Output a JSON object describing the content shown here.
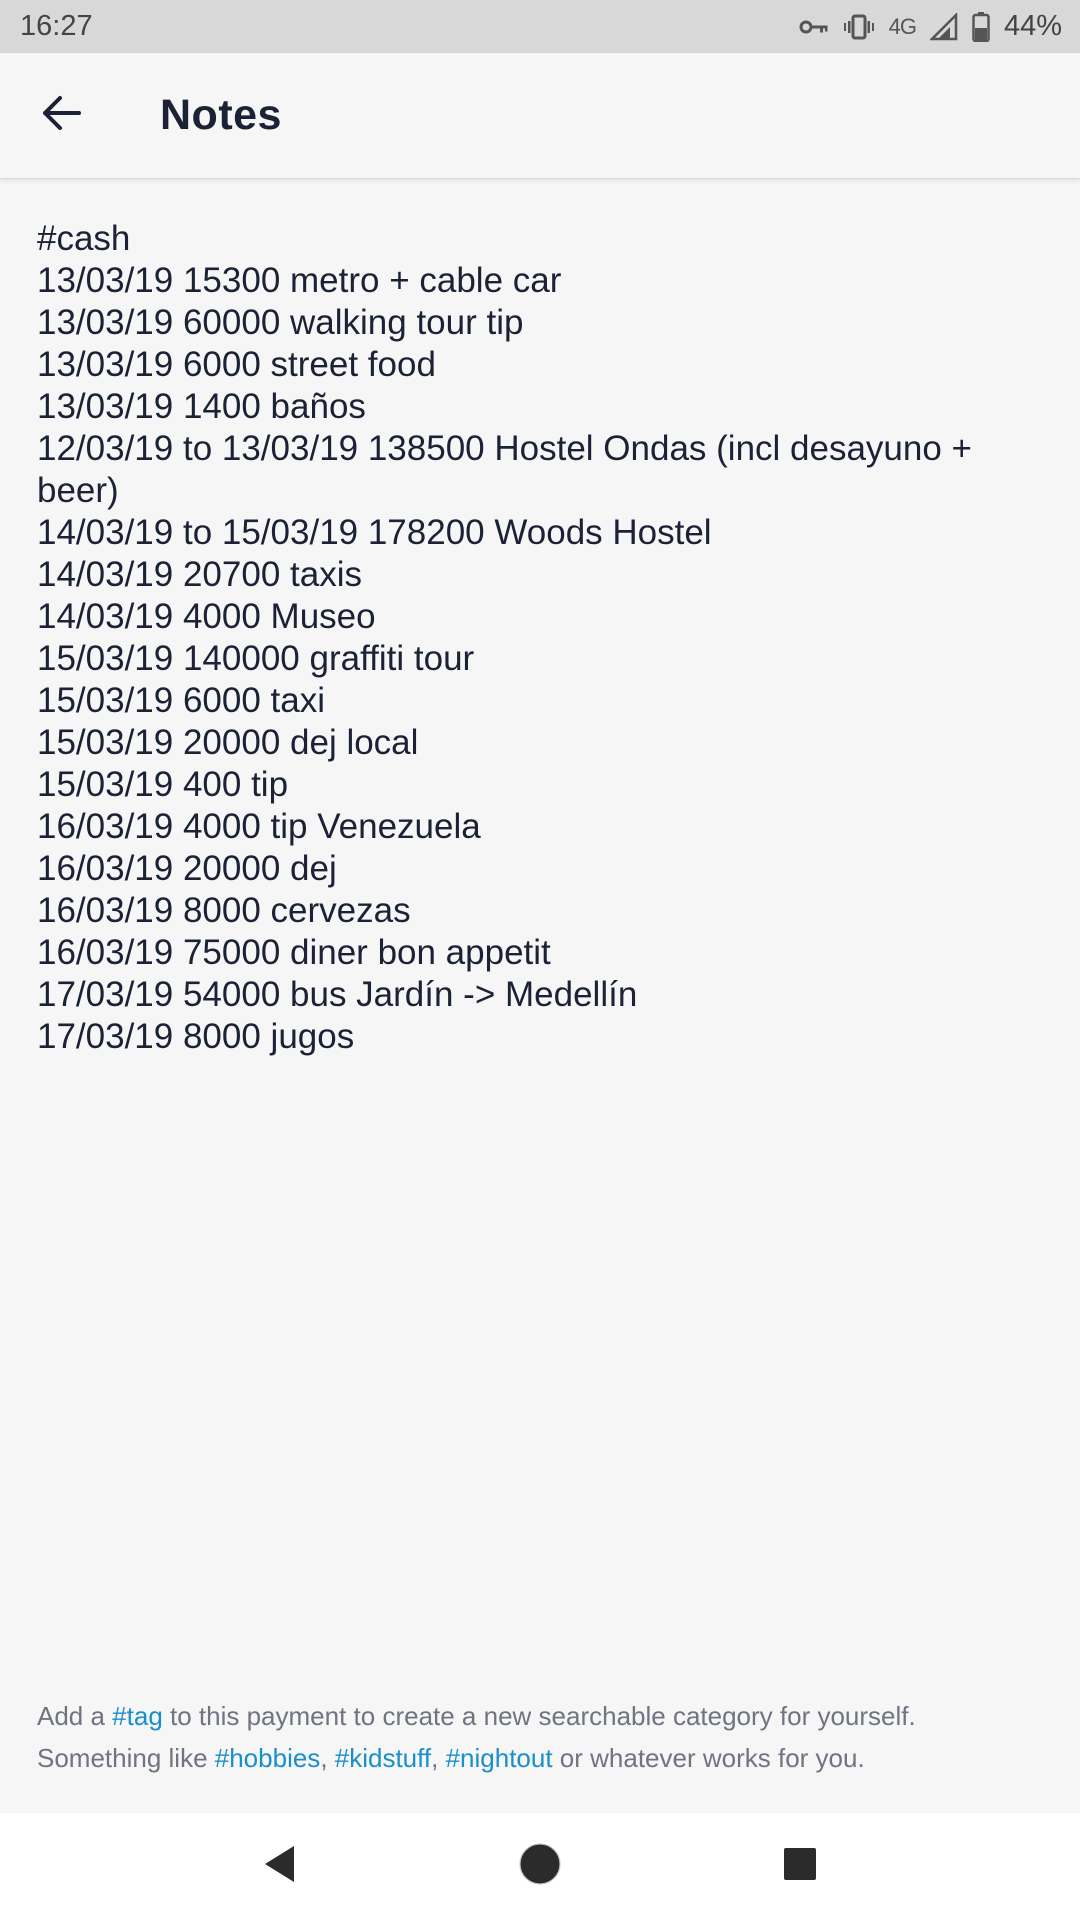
{
  "status_bar": {
    "time": "16:27",
    "network": "4G",
    "battery": "44%",
    "icons": [
      "vpn-key-icon",
      "vibrate-icon",
      "signal-icon",
      "battery-icon"
    ]
  },
  "app_bar": {
    "title": "Notes",
    "back_icon": "arrow-back-icon"
  },
  "note": {
    "lines": [
      "#cash",
      "13/03/19 15300 metro + cable car",
      "13/03/19 60000 walking tour tip",
      "13/03/19 6000 street food",
      "13/03/19 1400 baños",
      "12/03/19 to 13/03/19 138500 Hostel Ondas (incl desayuno + beer)",
      "14/03/19 to 15/03/19 178200 Woods Hostel",
      "14/03/19 20700 taxis",
      "14/03/19 4000 Museo",
      "15/03/19 140000 graffiti tour",
      "15/03/19 6000 taxi",
      "15/03/19 20000 dej local",
      "15/03/19 400 tip",
      "16/03/19 4000 tip Venezuela",
      "16/03/19 20000 dej",
      "16/03/19 8000 cervezas",
      "16/03/19 75000 diner bon appetit",
      "17/03/19 54000 bus Jardín -> Medellín",
      "17/03/19 8000 jugos"
    ]
  },
  "hint": {
    "part1": "Add a ",
    "tag": "#tag",
    "part2": " to this payment to create a new searchable category for yourself.",
    "part3": "Something like ",
    "tag_hobbies": "#hobbies",
    "comma1": ", ",
    "tag_kidstuff": "#kidstuff",
    "comma2": ", ",
    "tag_nightout": "#nightout",
    "part4": " or whatever works for you."
  },
  "nav_bar": {
    "icons": [
      "nav-back-icon",
      "nav-home-icon",
      "nav-recents-icon"
    ]
  },
  "colors": {
    "text": "#1b2235",
    "link": "#1a8fc9",
    "hint": "#6f7480",
    "background": "#f6f6f6",
    "status_bar": "#d8d8d8"
  }
}
